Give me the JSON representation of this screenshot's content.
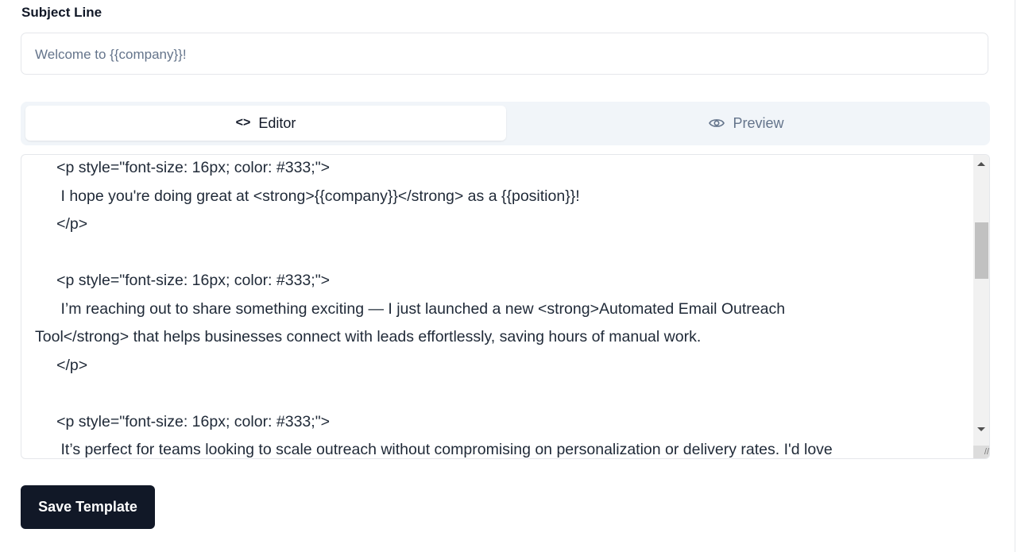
{
  "subject": {
    "label": "Subject Line",
    "value": "Welcome to {{company}}!"
  },
  "tabs": [
    {
      "label": "Editor",
      "icon": "code-icon",
      "active": true
    },
    {
      "label": "Preview",
      "icon": "eye-icon",
      "active": false
    }
  ],
  "editor": {
    "lines": [
      "     <p style=\"font-size: 16px; color: #333;\">",
      "      I hope you're doing great at <strong>{{company}}</strong> as a {{position}}!",
      "     </p>",
      "",
      "     <p style=\"font-size: 16px; color: #333;\">",
      "      I’m reaching out to share something exciting — I just launched a new <strong>Automated Email Outreach",
      "Tool</strong> that helps businesses connect with leads effortlessly, saving hours of manual work.",
      "     </p>",
      "",
      "     <p style=\"font-size: 16px; color: #333;\">",
      "      It’s perfect for teams looking to scale outreach without compromising on personalization or delivery rates. I'd love"
    ],
    "scroll_position_percent": 22
  },
  "save_label": "Save Template"
}
